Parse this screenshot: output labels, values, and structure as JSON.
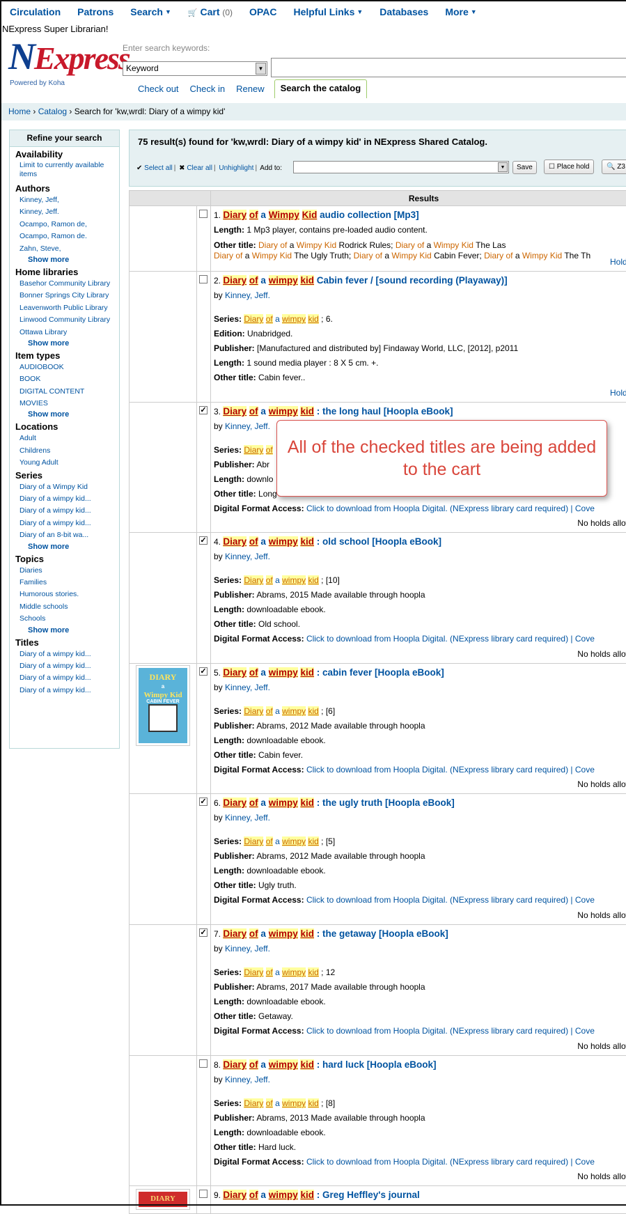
{
  "nav": {
    "items": [
      {
        "label": "Circulation",
        "caret": false
      },
      {
        "label": "Patrons",
        "caret": false
      },
      {
        "label": "Search",
        "caret": true
      },
      {
        "label": "Cart",
        "caret": false
      },
      {
        "label": "OPAC",
        "caret": false
      },
      {
        "label": "Helpful Links",
        "caret": true
      },
      {
        "label": "Databases",
        "caret": false
      },
      {
        "label": "More",
        "caret": true
      }
    ],
    "cart_count": "(0)",
    "user": "NExpress Super Librarian!"
  },
  "logo": {
    "first": "N",
    "rest": "Express",
    "powered": "Powered by Koha"
  },
  "search": {
    "hint": "Enter search keywords:",
    "type_value": "Keyword",
    "tabs": [
      "Check out",
      "Check in",
      "Renew",
      "Search the catalog"
    ]
  },
  "breadcrumb": {
    "home": "Home",
    "catalog": "Catalog",
    "current": "Search for 'kw,wrdl: Diary of a wimpy kid'"
  },
  "sidebar": {
    "title": "Refine your search",
    "show_more": "Show more",
    "availability": {
      "heading": "Availability",
      "item": "Limit to currently available items"
    },
    "authors": {
      "heading": "Authors",
      "items": [
        "Kinney, Jeff,",
        "Kinney, Jeff.",
        "Ocampo, Ramon de,",
        "Ocampo, Ramon de.",
        "Zahn, Steve,"
      ]
    },
    "libraries": {
      "heading": "Home libraries",
      "items": [
        "Basehor Community Library",
        "Bonner Springs City Library",
        "Leavenworth Public Library",
        "Linwood Community Library",
        "Ottawa Library"
      ]
    },
    "itemtypes": {
      "heading": "Item types",
      "items": [
        "AUDIOBOOK",
        "BOOK",
        "DIGITAL CONTENT",
        "MOVIES"
      ]
    },
    "locations": {
      "heading": "Locations",
      "items": [
        "Adult",
        "Childrens",
        "Young Adult"
      ]
    },
    "series": {
      "heading": "Series",
      "items": [
        "Diary of a Wimpy Kid",
        "Diary of a wimpy kid...",
        "Diary of a wimpy kid...",
        "Diary of a wimpy kid...",
        "Diary of an 8-bit wa..."
      ]
    },
    "topics": {
      "heading": "Topics",
      "items": [
        "Diaries",
        "Families",
        "Humorous stories.",
        "Middle schools",
        "Schools"
      ]
    },
    "titles": {
      "heading": "Titles",
      "items": [
        "Diary of a wimpy kid...",
        "Diary of a wimpy kid...",
        "Diary of a wimpy kid...",
        "Diary of a wimpy kid..."
      ]
    }
  },
  "results": {
    "summary": "75 result(s) found for 'kw,wrdl: Diary of a wimpy kid' in NExpress Shared Catalog.",
    "select_all": "Select all",
    "clear_all": "Clear all",
    "unhighlight": "Unhighlight",
    "add_to": "Add to:",
    "save": "Save",
    "place_hold": "Place hold",
    "z3950": "Z3",
    "column": "Results",
    "by": "by",
    "author": "Kinney, Jeff.",
    "holds_label": "Holds (",
    "no_holds": "No holds allowe",
    "hoopla_link": "Click to download from Hoopla Digital. (NExpress library card required) | Cove",
    "labels": {
      "length": "Length:",
      "other_title": "Other title:",
      "series": "Series:",
      "edition": "Edition:",
      "publisher": "Publisher:",
      "digital": "Digital Format Access:"
    },
    "words": {
      "diary": "Diary",
      "of": "of",
      "a": "a",
      "wimpy": "wimpy",
      "Wimpy": "Wimpy",
      "kid": "kid",
      "Kid": "Kid"
    },
    "r1": {
      "num": "1.",
      "checked": false,
      "title_rest": "audio collection [Mp3]",
      "length": "1 Mp3 player, contains pre-loaded audio content.",
      "ot_a": "Rodrick Rules;",
      "ot_b": "The Las",
      "ot_c": "The Ugly Truth;",
      "ot_d": "Cabin Fever;",
      "ot_e": "The Th"
    },
    "r2": {
      "num": "2.",
      "checked": false,
      "title_rest": "Cabin fever / [sound recording (Playaway)]",
      "series_tail": "; 6.",
      "edition": "Unabridged.",
      "publisher": "[Manufactured and distributed by] Findaway World, LLC, [2012], p2011",
      "length": "1 sound media player : 8 X 5 cm. +.",
      "other_title": "Cabin fever.."
    },
    "r3": {
      "num": "3.",
      "checked": true,
      "title_rest": ": the long haul [Hoopla eBook]",
      "publisher": "Abr",
      "length": "downlo",
      "other_title": "Long haul."
    },
    "r4": {
      "num": "4.",
      "checked": true,
      "title_rest": ": old school [Hoopla eBook]",
      "series_tail": "; [10]",
      "publisher": "Abrams, 2015 Made available through hoopla",
      "length": "downloadable ebook.",
      "other_title": "Old school."
    },
    "r5": {
      "num": "5.",
      "checked": true,
      "title_rest": ": cabin fever [Hoopla eBook]",
      "series_tail": "; [6]",
      "publisher": "Abrams, 2012 Made available through hoopla",
      "length": "downloadable ebook.",
      "other_title": "Cabin fever."
    },
    "r6": {
      "num": "6.",
      "checked": true,
      "title_rest": ": the ugly truth [Hoopla eBook]",
      "series_tail": "; [5]",
      "publisher": "Abrams, 2012 Made available through hoopla",
      "length": "downloadable ebook.",
      "other_title": "Ugly truth."
    },
    "r7": {
      "num": "7.",
      "checked": true,
      "title_rest": ": the getaway [Hoopla eBook]",
      "series_tail": "; 12",
      "publisher": "Abrams, 2017 Made available through hoopla",
      "length": "downloadable ebook.",
      "other_title": "Getaway."
    },
    "r8": {
      "num": "8.",
      "checked": false,
      "title_rest": ": hard luck [Hoopla eBook]",
      "series_tail": "; [8]",
      "publisher": "Abrams, 2013 Made available through hoopla",
      "length": "downloadable ebook.",
      "other_title": "Hard luck."
    },
    "r9": {
      "num": "9.",
      "checked": false,
      "title_rest": ": Greg Heffley's journal"
    }
  },
  "covers": {
    "cover5": {
      "line1": "DIARY",
      "line2": "a",
      "line3": "Wimpy Kid",
      "line4": "CABIN FEVER"
    },
    "cover9": {
      "line1": "DIARY"
    }
  },
  "callout": {
    "text": "All of the checked titles are being added to the cart"
  }
}
